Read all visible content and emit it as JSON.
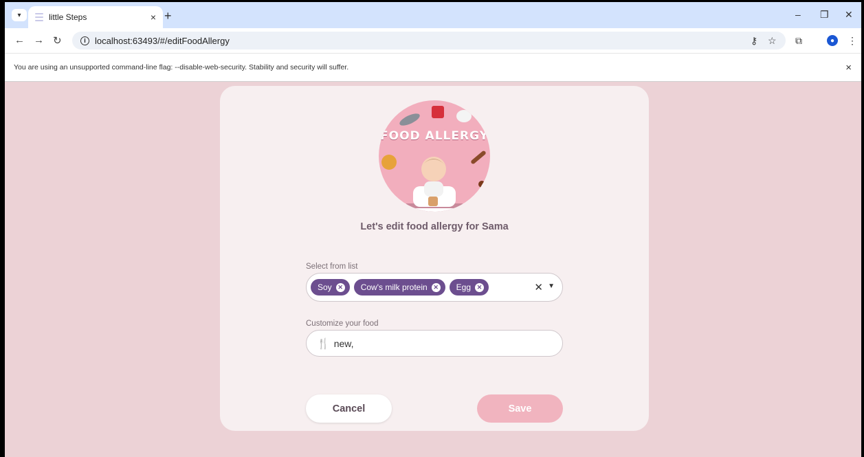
{
  "browser": {
    "tab_title": "little Steps",
    "tab_close": "×",
    "new_tab": "+",
    "url": "localhost:63493/#/editFoodAllergy",
    "info_bar_text": "You are using an unsupported command-line flag: --disable-web-security. Stability and security will suffer.",
    "info_bar_close": "×"
  },
  "page": {
    "hero_caption": "FOOD ALLERGY",
    "subtitle": "Let's edit food allergy for Sama",
    "select_label": "Select from list",
    "selected_allergies": [
      "Soy",
      "Cow's milk protein",
      "Egg"
    ],
    "custom_label": "Customize your food",
    "custom_value": "new,",
    "cancel_label": "Cancel",
    "save_label": "Save"
  },
  "colors": {
    "page_bg": "#ecd2d6",
    "card_bg": "#f7eff0",
    "chip": "#6c4e8f",
    "save_button": "#f1b4bf",
    "hero_bg": "#f2aebd"
  },
  "icons": [
    "tab-list-icon",
    "tab-favicon",
    "back-icon",
    "forward-icon",
    "reload-icon",
    "site-info-icon",
    "password-key-icon",
    "bookmark-star-icon",
    "extensions-icon",
    "profile-icon",
    "menu-kebab-icon",
    "minimize-icon",
    "restore-icon",
    "close-window-icon",
    "chip-remove-icon",
    "clear-icon",
    "dropdown-arrow-icon",
    "utensils-icon"
  ]
}
